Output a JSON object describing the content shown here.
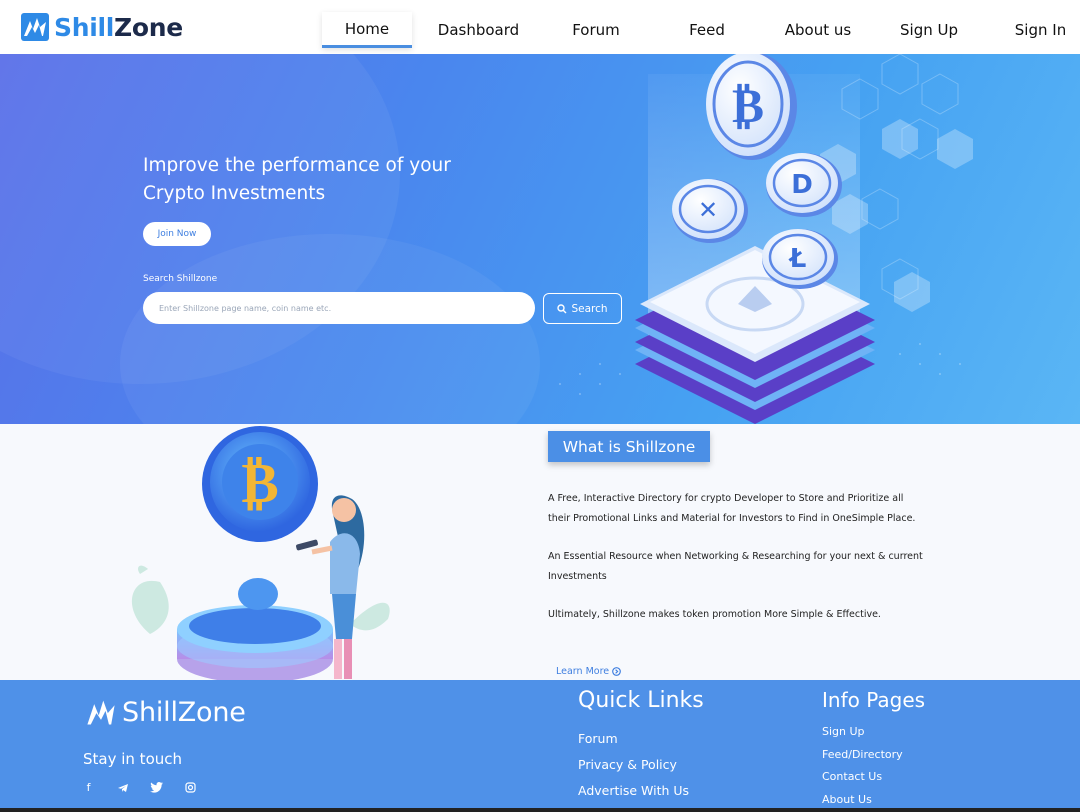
{
  "brand": {
    "name_part1": "Shill",
    "name_part2": "Zone",
    "footer_name": "ShillZone"
  },
  "nav": {
    "items": [
      {
        "label": "Home",
        "active": true
      },
      {
        "label": "Dashboard",
        "active": false
      },
      {
        "label": "Forum",
        "active": false
      },
      {
        "label": "Feed",
        "active": false
      },
      {
        "label": "About us",
        "active": false
      },
      {
        "label": "Sign Up",
        "active": false
      },
      {
        "label": "Sign In",
        "active": false
      }
    ]
  },
  "hero": {
    "headline_line1": "Improve the performance of your",
    "headline_line2": "Crypto Investments",
    "join_button": "Join Now",
    "search_label": "Search Shillzone",
    "search_placeholder": "Enter Shillzone page name, coin name etc.",
    "search_button": "Search"
  },
  "about": {
    "badge": "What is Shillzone",
    "paragraphs": [
      "A Free, Interactive Directory for crypto Developer to Store and Prioritize all their Promotional Links and Material for Investors to Find in OneSimple Place.",
      "An Essential Resource when Networking & Researching for your next & current Investments",
      "Ultimately, Shillzone makes token promotion More Simple & Effective."
    ],
    "learn_more": "Learn More"
  },
  "footer": {
    "stay_in_touch": "Stay in touch",
    "socials": [
      "facebook-icon",
      "telegram-icon",
      "twitter-icon",
      "instagram-icon"
    ],
    "quick_links": {
      "title": "Quick Links",
      "items": [
        "Forum",
        "Privacy & Policy",
        "Advertise With Us"
      ]
    },
    "info_pages": {
      "title": "Info Pages",
      "items": [
        "Sign Up",
        "Feed/Directory",
        "Contact Us",
        "About Us"
      ]
    }
  },
  "colors": {
    "brand_blue": "#2e8ae6",
    "hero_start": "#5a6fe8",
    "hero_end": "#5ab6f5",
    "footer_bg": "#4f91e8",
    "badge_bg": "#4b8fe6"
  }
}
